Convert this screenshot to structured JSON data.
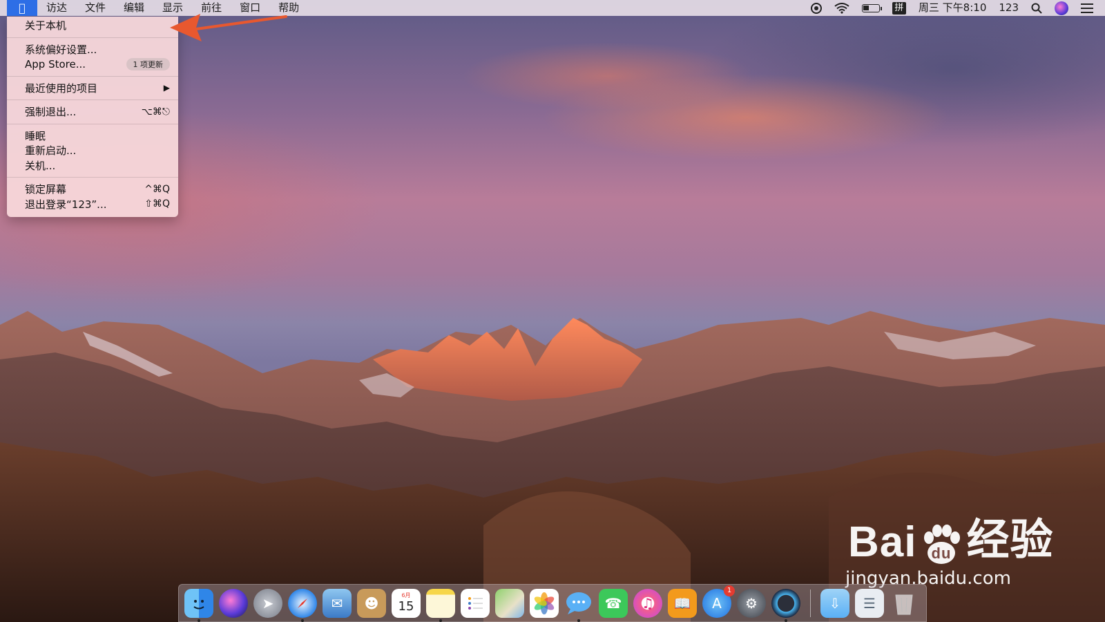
{
  "menubar": {
    "apple_icon": "apple-icon",
    "items": [
      {
        "label": "访达"
      },
      {
        "label": "文件"
      },
      {
        "label": "编辑"
      },
      {
        "label": "显示"
      },
      {
        "label": "前往"
      },
      {
        "label": "窗口"
      },
      {
        "label": "帮助"
      }
    ],
    "status": {
      "clock": "周三 下午8:10",
      "user": "123",
      "ime": "拼"
    }
  },
  "apple_menu": {
    "about": "关于本机",
    "prefs": "系统偏好设置...",
    "app_store": "App Store...",
    "app_store_badge": "1 项更新",
    "recent": "最近使用的项目",
    "force_quit": "强制退出...",
    "force_quit_shortcut": "⌥⌘⎋",
    "sleep": "睡眠",
    "restart": "重新启动...",
    "shutdown": "关机...",
    "lock": "锁定屏幕",
    "lock_shortcut": "^⌘Q",
    "logout": "退出登录“123”...",
    "logout_shortcut": "⇧⌘Q"
  },
  "dock": {
    "calendar_month": "6月",
    "calendar_day": "15",
    "app_store_badge": "1"
  },
  "watermark": {
    "brand_a": "Bai",
    "brand_b": "经验",
    "url": "jingyan.baidu.com"
  },
  "colors": {
    "accent": "#2d6ee6",
    "arrow": "#e8582f"
  }
}
